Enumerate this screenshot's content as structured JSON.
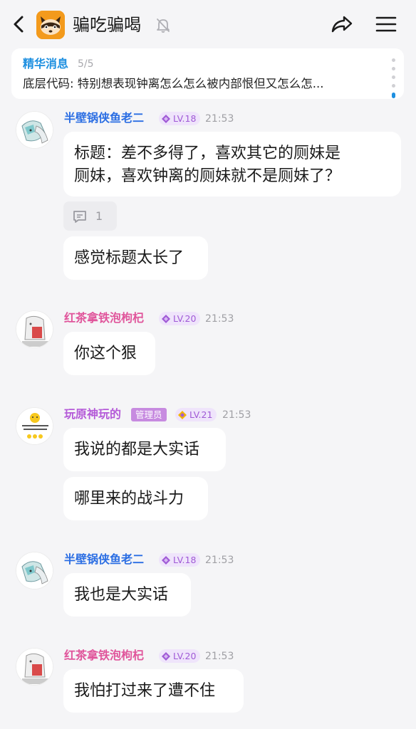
{
  "header": {
    "back_icon": "chevron-left-icon",
    "group_avatar_icon": "raccoon-icon",
    "title": "骗吃骗喝",
    "mute_icon": "bell-off-icon",
    "share_icon": "share-icon",
    "menu_icon": "hamburger-menu-icon"
  },
  "featured": {
    "title": "精华消息",
    "count": "5/5",
    "text": "底层代码: 特别想表现钟离怎么怎么被内部恨但又怎么怎..."
  },
  "messages": [
    {
      "user": "半壁锅侠鱼老二",
      "level": "LV.18",
      "time": "21:53",
      "bubbles": [
        "标题：差不多得了，喜欢其它的厕妹是\n厕妹，喜欢钟离的厕妹就不是厕妹了？",
        "感觉标题太长了"
      ],
      "reply_count": "1"
    },
    {
      "user": "红茶拿铁泡枸杞",
      "level": "LV.20",
      "time": "21:53",
      "bubbles": [
        "你这个狠"
      ]
    },
    {
      "user": "玩原神玩的",
      "admin": "管理员",
      "level": "LV.21",
      "time": "21:53",
      "bubbles": [
        "我说的都是大实话",
        "哪里来的战斗力"
      ]
    },
    {
      "user": "半壁锅侠鱼老二",
      "level": "LV.18",
      "time": "21:53",
      "bubbles": [
        "我也是大实话"
      ]
    },
    {
      "user": "红茶拿铁泡枸杞",
      "level": "LV.20",
      "time": "21:53",
      "bubbles": [
        "我怕打过来了遭不住"
      ]
    }
  ],
  "colors": {
    "accent": "#1d8fe0",
    "name_blue": "#2b6ee3",
    "name_pink": "#e0559b",
    "name_purple": "#b45ad8",
    "level_badge_bg": "#efe4fb",
    "admin_badge_bg": "#c78be0"
  }
}
